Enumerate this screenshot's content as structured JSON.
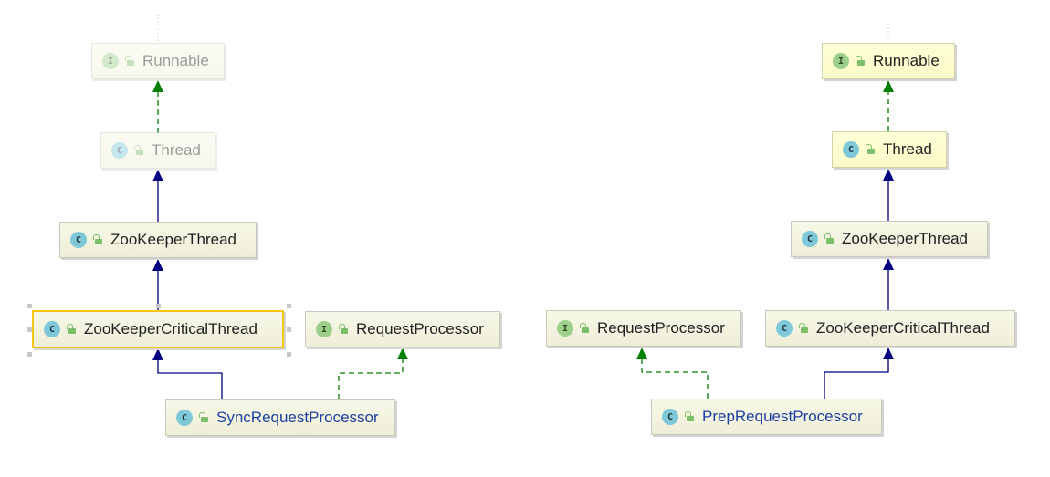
{
  "diagram": {
    "left": {
      "nodes": [
        {
          "id": "runnable",
          "kind": "interface",
          "badge": "I",
          "label": "Runnable",
          "style": "faded"
        },
        {
          "id": "thread",
          "kind": "class",
          "badge": "C",
          "label": "Thread",
          "style": "faded"
        },
        {
          "id": "zookeeper-thread",
          "kind": "class",
          "badge": "C",
          "label": "ZooKeeperThread",
          "style": "normal"
        },
        {
          "id": "zookeeper-critical-thread",
          "kind": "class",
          "badge": "C",
          "label": "ZooKeeperCriticalThread",
          "style": "selected"
        },
        {
          "id": "request-processor",
          "kind": "interface",
          "badge": "I",
          "label": "RequestProcessor",
          "style": "normal"
        },
        {
          "id": "sync-request-processor",
          "kind": "class",
          "badge": "C",
          "label": "SyncRequestProcessor",
          "style": "focus"
        }
      ],
      "edges": [
        {
          "from": "thread",
          "to": "runnable",
          "type": "implements"
        },
        {
          "from": "zookeeper-thread",
          "to": "thread",
          "type": "extends"
        },
        {
          "from": "zookeeper-critical-thread",
          "to": "zookeeper-thread",
          "type": "extends"
        },
        {
          "from": "sync-request-processor",
          "to": "zookeeper-critical-thread",
          "type": "extends"
        },
        {
          "from": "sync-request-processor",
          "to": "request-processor",
          "type": "implements"
        }
      ]
    },
    "right": {
      "nodes": [
        {
          "id": "runnable",
          "kind": "interface",
          "badge": "I",
          "label": "Runnable",
          "style": "highlight"
        },
        {
          "id": "thread",
          "kind": "class",
          "badge": "C",
          "label": "Thread",
          "style": "highlight"
        },
        {
          "id": "zookeeper-thread",
          "kind": "class",
          "badge": "C",
          "label": "ZooKeeperThread",
          "style": "normal"
        },
        {
          "id": "request-processor",
          "kind": "interface",
          "badge": "I",
          "label": "RequestProcessor",
          "style": "normal"
        },
        {
          "id": "zookeeper-critical-thread",
          "kind": "class",
          "badge": "C",
          "label": "ZooKeeperCriticalThread",
          "style": "normal"
        },
        {
          "id": "prep-request-processor",
          "kind": "class",
          "badge": "C",
          "label": "PrepRequestProcessor",
          "style": "focus"
        }
      ],
      "edges": [
        {
          "from": "thread",
          "to": "runnable",
          "type": "implements"
        },
        {
          "from": "zookeeper-thread",
          "to": "thread",
          "type": "extends"
        },
        {
          "from": "zookeeper-critical-thread",
          "to": "zookeeper-thread",
          "type": "extends"
        },
        {
          "from": "prep-request-processor",
          "to": "zookeeper-critical-thread",
          "type": "extends"
        },
        {
          "from": "prep-request-processor",
          "to": "request-processor",
          "type": "implements"
        }
      ]
    },
    "colors": {
      "extends": "#000080",
      "implements": "#008000",
      "selection": "#f5c518",
      "focus_text": "#1c3fa0"
    }
  }
}
